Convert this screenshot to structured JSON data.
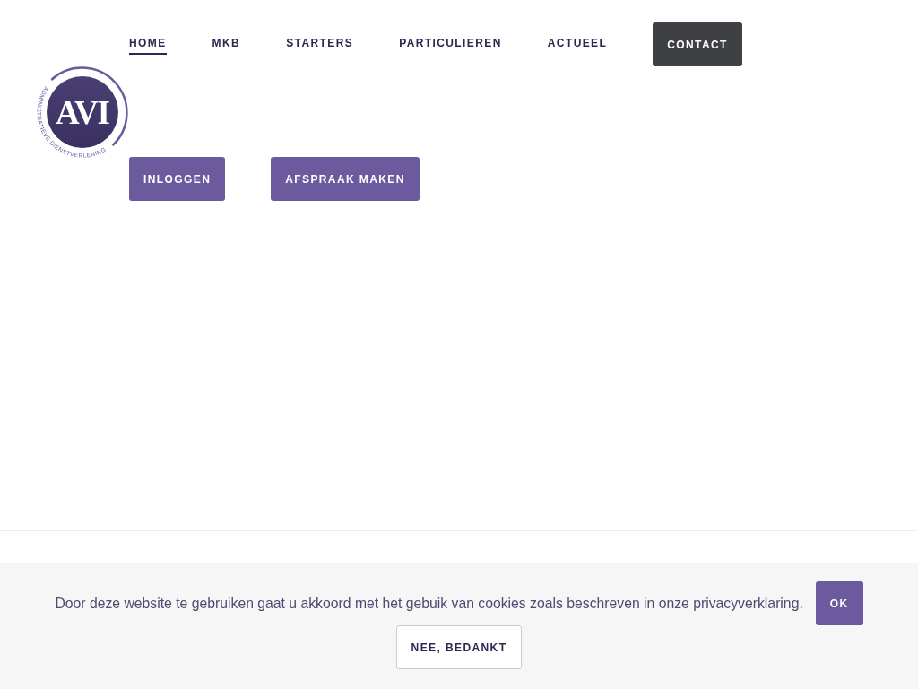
{
  "logo": {
    "monogram": "AVI",
    "tagline": "ADMINISTRATIEVE DIENSTVERLENING"
  },
  "nav": {
    "items": [
      {
        "label": "HOME",
        "kind": "link",
        "selected": true
      },
      {
        "label": "MKB",
        "kind": "link",
        "selected": false
      },
      {
        "label": "STARTERS",
        "kind": "link",
        "selected": false
      },
      {
        "label": "PARTICULIEREN",
        "kind": "link",
        "selected": false
      },
      {
        "label": "ACTUEEL",
        "kind": "link",
        "selected": false
      },
      {
        "label": "CONTACT",
        "kind": "button",
        "selected": false
      }
    ]
  },
  "hero": {
    "buttons": [
      "INLOGGEN",
      "AFSPRAAK MAKEN"
    ]
  },
  "cookie_banner": {
    "message": "Door deze website te gebruiken gaat u akkoord met het gebuik van cookies zoals beschreven in onze privacyverklaring.",
    "accept": "OK",
    "decline": "NEE, BEDANKT"
  }
}
